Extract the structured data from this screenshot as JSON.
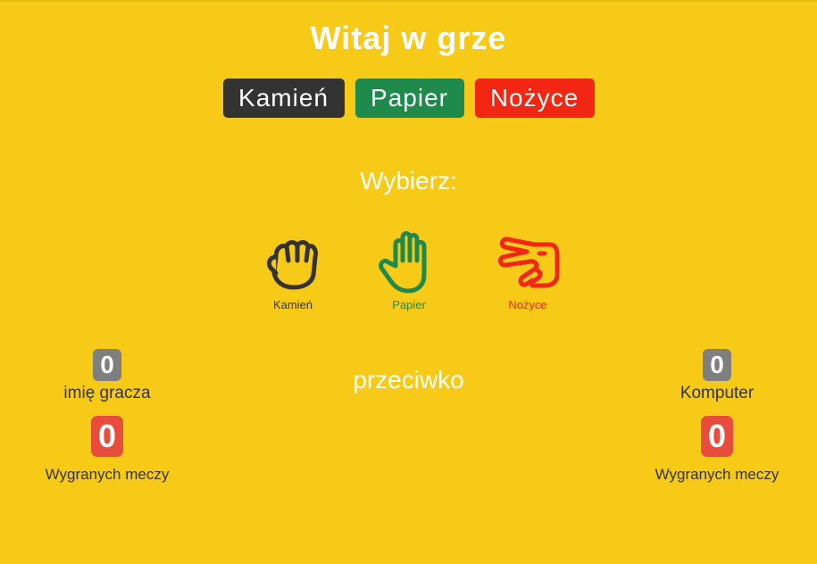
{
  "header": {
    "title": "Witaj w grze"
  },
  "buttons": {
    "rock": "Kamień",
    "paper": "Papier",
    "scissors": "Nożyce"
  },
  "prompt": "Wybierz:",
  "choices": [
    {
      "label": "Kamień",
      "icon": "fist-icon",
      "color": "#333333"
    },
    {
      "label": "Papier",
      "icon": "open-hand-icon",
      "color": "#1e8a4c"
    },
    {
      "label": "Nożyce",
      "icon": "scissors-hand-icon",
      "color": "#f22613"
    }
  ],
  "versus": "przeciwko",
  "player": {
    "score": "0",
    "name": "imię gracza",
    "wins": "0",
    "wins_label": "Wygranych meczy"
  },
  "computer": {
    "score": "0",
    "name": "Komputer",
    "wins": "0",
    "wins_label": "Wygranych meczy"
  },
  "colors": {
    "background": "#f7ca18",
    "rock": "#333333",
    "paper": "#1e8a4c",
    "scissors": "#f22613",
    "score_badge": "#7f7f7f",
    "wins_badge": "#e74c3c"
  }
}
